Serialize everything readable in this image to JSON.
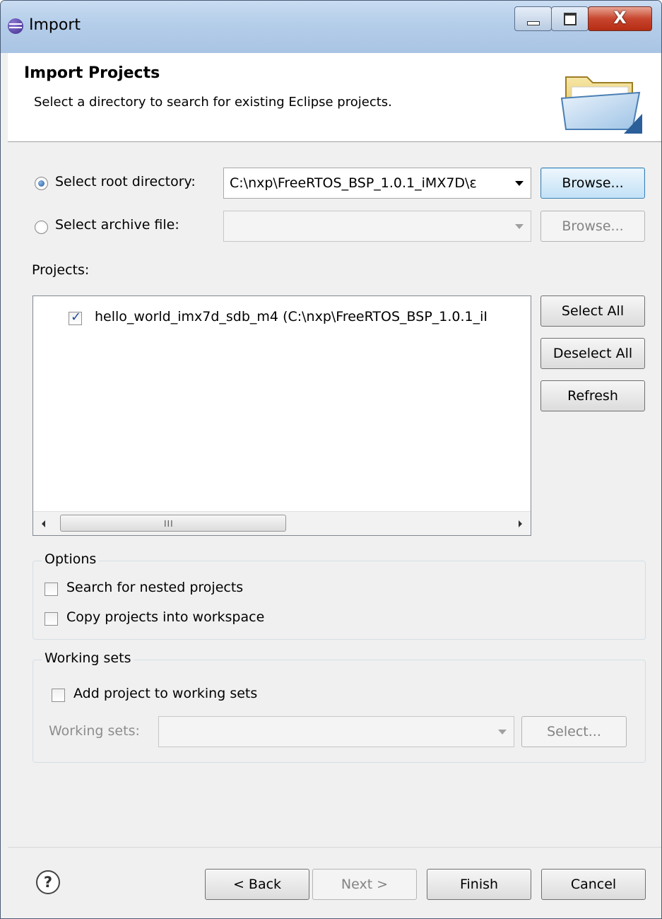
{
  "window": {
    "title": "Import",
    "close_glyph": "X",
    "controls": [
      "minimize-icon",
      "maximize-icon",
      "close-icon"
    ]
  },
  "header": {
    "title": "Import Projects",
    "description": "Select a directory to search for existing Eclipse projects.",
    "icon": "folder-icon"
  },
  "source": {
    "root_directory_label": "Select root directory:",
    "root_directory_value": "C:\\nxp\\FreeRTOS_BSP_1.0.1_iMX7D\\ε",
    "root_directory_selected": true,
    "archive_file_label": "Select archive file:",
    "archive_file_value": "",
    "browse_label": "Browse..."
  },
  "projects": {
    "label": "Projects:",
    "items": [
      {
        "label": "hello_world_imx7d_sdb_m4 (C:\\nxp\\FreeRTOS_BSP_1.0.1_iI",
        "checked": true
      }
    ],
    "select_all": "Select All",
    "deselect_all": "Deselect All",
    "refresh": "Refresh",
    "scrollbar_grip": "III"
  },
  "options": {
    "title": "Options",
    "search_nested": "Search for nested projects",
    "copy_into_workspace": "Copy projects into workspace"
  },
  "working_sets": {
    "title": "Working sets",
    "add_to_working_sets": "Add project to working sets",
    "working_sets_label": "Working sets:",
    "select_button": "Select..."
  },
  "footer": {
    "help": "?",
    "back": "< Back",
    "next": "Next >",
    "finish": "Finish",
    "cancel": "Cancel"
  }
}
